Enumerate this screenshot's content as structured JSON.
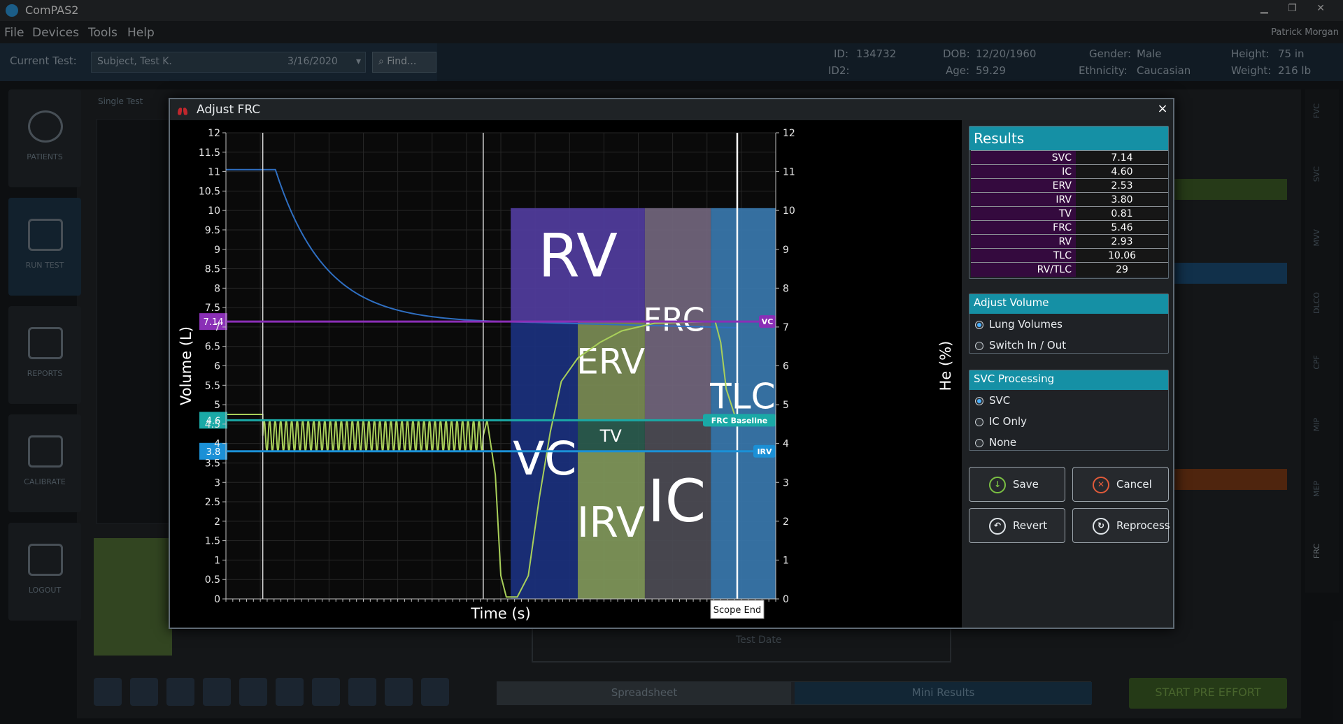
{
  "app": {
    "title": "ComPAS2",
    "menu": [
      "File",
      "Devices",
      "Tools",
      "Help"
    ],
    "user": "Patrick Morgan",
    "current_test_label": "Current Test:",
    "current_test_value": "Subject, Test K.",
    "current_test_date": "3/16/2020",
    "find_label": "Find...",
    "patient": {
      "id_label": "ID:",
      "id": "134732",
      "id2_label": "ID2:",
      "id2": "",
      "dob_label": "DOB:",
      "dob": "12/20/1960",
      "age_label": "Age:",
      "age": "59.29",
      "gender_label": "Gender:",
      "gender": "Male",
      "ethnicity_label": "Ethnicity:",
      "ethnicity": "Caucasian",
      "height_label": "Height:",
      "height": "75 in",
      "weight_label": "Weight:",
      "weight": "216 lb"
    },
    "nav": [
      "PATIENTS",
      "RUN TEST",
      "REPORTS",
      "CALIBRATE",
      "LOGOUT"
    ],
    "bg_tab": "Single Test",
    "bottom_tabs": [
      "Spreadsheet",
      "Mini Results"
    ],
    "start_button": "START PRE EFFORT",
    "test_date_label": "Test Date",
    "right_nav": [
      "FVC",
      "SVC",
      "MVV",
      "DLCO",
      "CPF",
      "MIP",
      "MEP",
      "FRC"
    ]
  },
  "dialog": {
    "title": "Adjust FRC",
    "close_label": "×"
  },
  "chart_data": {
    "type": "line",
    "xlabel": "Time (s)",
    "ylabel": "Volume (L)",
    "y2label": "He (%)",
    "ylim": [
      0,
      12
    ],
    "y2lim": [
      0,
      12
    ],
    "y_ticks": [
      "0",
      "0.5",
      "1",
      "1.5",
      "2",
      "2.5",
      "3",
      "3.5",
      "4",
      "4.5",
      "5",
      "5.5",
      "6",
      "6.5",
      "7",
      "7.5",
      "8",
      "8.5",
      "9",
      "9.5",
      "10",
      "10.5",
      "11",
      "11.5",
      "12"
    ],
    "y2_ticks": [
      "0",
      "1",
      "2",
      "3",
      "4",
      "5",
      "6",
      "7",
      "8",
      "9",
      "10",
      "11",
      "12"
    ],
    "markers": [
      {
        "name": "VC",
        "value": 7.14,
        "label": "7.14",
        "color": "#8a2fb6"
      },
      {
        "name": "FRC Baseline",
        "value": 4.6,
        "label": "4.6",
        "color": "#1aa9a6"
      },
      {
        "name": "IRV",
        "value": 3.8,
        "label": "3.8",
        "color": "#1b90d6"
      }
    ],
    "regions": [
      {
        "label": "RV",
        "color": "#4f3b9a"
      },
      {
        "label": "VC",
        "color": "#1a2f7a"
      },
      {
        "label": "ERV",
        "color": "#778852"
      },
      {
        "label": "TV",
        "color": "#2a5a4d"
      },
      {
        "label": "IRV",
        "color": "#7d9458"
      },
      {
        "label": "FRC",
        "color": "#6f6379"
      },
      {
        "label": "IC",
        "color": "#4b4a52"
      },
      {
        "label": "TLC",
        "color": "#3a7ab0"
      }
    ],
    "scope_end_label": "Scope End"
  },
  "results": {
    "title": "Results",
    "rows": [
      {
        "k": "SVC",
        "v": "7.14"
      },
      {
        "k": "IC",
        "v": "4.60"
      },
      {
        "k": "ERV",
        "v": "2.53"
      },
      {
        "k": "IRV",
        "v": "3.80"
      },
      {
        "k": "TV",
        "v": "0.81"
      },
      {
        "k": "FRC",
        "v": "5.46"
      },
      {
        "k": "RV",
        "v": "2.93"
      },
      {
        "k": "TLC",
        "v": "10.06"
      },
      {
        "k": "RV/TLC",
        "v": "29"
      }
    ]
  },
  "adjust_volume": {
    "title": "Adjust Volume",
    "options": [
      "Lung Volumes",
      "Switch In / Out"
    ],
    "selected": 0
  },
  "svc_processing": {
    "title": "SVC Processing",
    "options": [
      "SVC",
      "IC Only",
      "None"
    ],
    "selected": 0
  },
  "buttons": {
    "save": "Save",
    "cancel": "Cancel",
    "revert": "Revert",
    "reprocess": "Reprocess"
  },
  "colors": {
    "accent": "#1590a5",
    "vc_line": "#8a2fb6",
    "frc_line": "#1aa9a6",
    "irv_line": "#1b90d6",
    "he_curve": "#2f6fc2",
    "volume_curve": "#a9d05a"
  }
}
